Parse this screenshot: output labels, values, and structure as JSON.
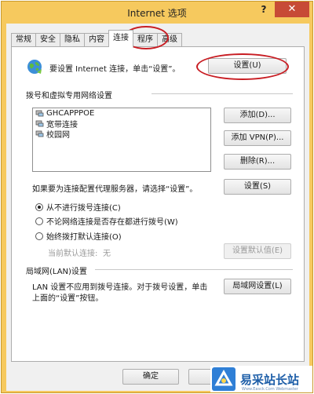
{
  "window": {
    "title": "Internet 选项",
    "help_glyph": "?",
    "close_glyph": "✕"
  },
  "tabs": [
    {
      "label": "常规"
    },
    {
      "label": "安全"
    },
    {
      "label": "隐私"
    },
    {
      "label": "内容"
    },
    {
      "label": "连接",
      "active": true
    },
    {
      "label": "程序"
    },
    {
      "label": "高级"
    }
  ],
  "setup": {
    "text": "要设置 Internet 连接，单击“设置”。",
    "button": "设置(U)"
  },
  "dialup": {
    "section_title": "拨号和虚拟专用网络设置",
    "connections": [
      "GHCAPPPOE",
      "宽带连接",
      "校园网"
    ],
    "add_button": "添加(D)...",
    "add_vpn_button": "添加 VPN(P)...",
    "remove_button": "删除(R)...",
    "proxy_text": "如果要为连接配置代理服务器，请选择“设置”。",
    "settings_button": "设置(S)"
  },
  "dial_options": [
    {
      "label": "从不进行拨号连接(C)",
      "selected": true
    },
    {
      "label": "不论网络连接是否存在都进行拨号(W)",
      "selected": false
    },
    {
      "label": "始终拨打默认连接(O)",
      "selected": false
    }
  ],
  "default_connection": {
    "label": "当前默认连接:",
    "value": "无",
    "button": "设置默认值(E)"
  },
  "lan": {
    "section_title": "局域网(LAN)设置",
    "text_line1": "LAN 设置不应用到拨号连接。对于拨号设置，单击",
    "text_line2": "上面的“设置”按钮。",
    "button": "局域网设置(L)"
  },
  "footer": {
    "ok_button": "确定"
  },
  "watermark": {
    "text": "易采站长站",
    "sub": "Www.Easck.Com Webmaster"
  },
  "colors": {
    "frame": "#f6c95e",
    "close": "#c74a36",
    "annotation": "#c81d23",
    "watermark": "#1d5ea8"
  }
}
